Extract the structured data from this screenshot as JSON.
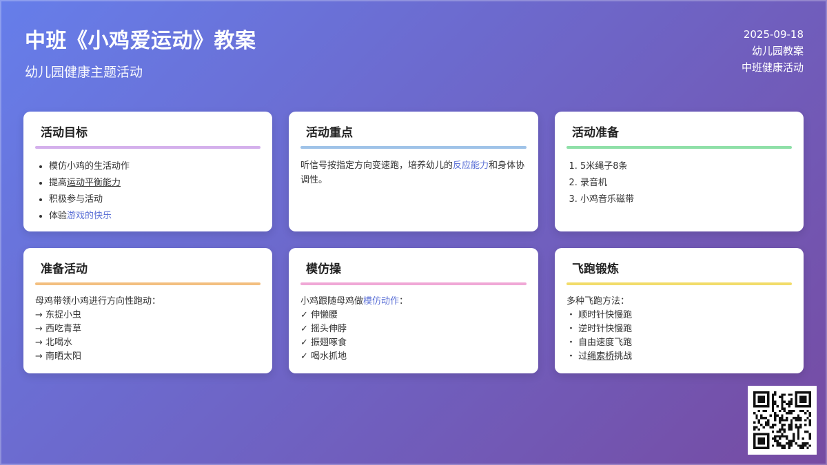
{
  "header": {
    "title": "中班《小鸡爱运动》教案",
    "subtitle": "幼儿园健康主题活动",
    "date": "2025-09-18",
    "tag1": "幼儿园教案",
    "tag2": "中班健康活动"
  },
  "colors": {
    "goals": "#d4b0ec",
    "focus": "#9fc3e8",
    "prep": "#8fe0a8",
    "warmup": "#f3bf80",
    "imitate": "#f0a8d6",
    "run": "#f2dc6a",
    "highlight": "#5a6fd6"
  },
  "cards": {
    "goals": {
      "title": "活动目标",
      "items": [
        "模仿小鸡的生活动作",
        "提高",
        "运动平衡能力",
        "积极参与活动",
        "体验",
        "游戏的快乐"
      ]
    },
    "focus": {
      "title": "活动重点",
      "text_a": "听信号按指定方向变速跑，培养幼儿的",
      "text_hl": "反应能力",
      "text_b": "和身体协调性。"
    },
    "prep": {
      "title": "活动准备",
      "items": [
        "5米绳子8条",
        "录音机",
        "小鸡音乐磁带"
      ]
    },
    "warmup": {
      "title": "准备活动",
      "intro": "母鸡带领小鸡进行方向性跑动：",
      "items": [
        "→ 东捉小虫",
        "→ 西吃青草",
        "→ 北喝水",
        "→ 南晒太阳"
      ]
    },
    "imitate": {
      "title": "模仿操",
      "intro_a": "小鸡跟随母鸡做",
      "intro_hl": "模仿动作",
      "intro_b": "：",
      "items": [
        "✓ 伸懒腰",
        "✓ 摇头伸脖",
        "✓ 振翅啄食",
        "✓ 喝水抓地"
      ]
    },
    "run": {
      "title": "飞跑锻炼",
      "intro": "多种飞跑方法：",
      "items": [
        "・ 顺时针快慢跑",
        "・ 逆时针快慢跑",
        "・ 自由速度飞跑",
        "・ 过",
        "绳索桥",
        "挑战"
      ]
    }
  }
}
